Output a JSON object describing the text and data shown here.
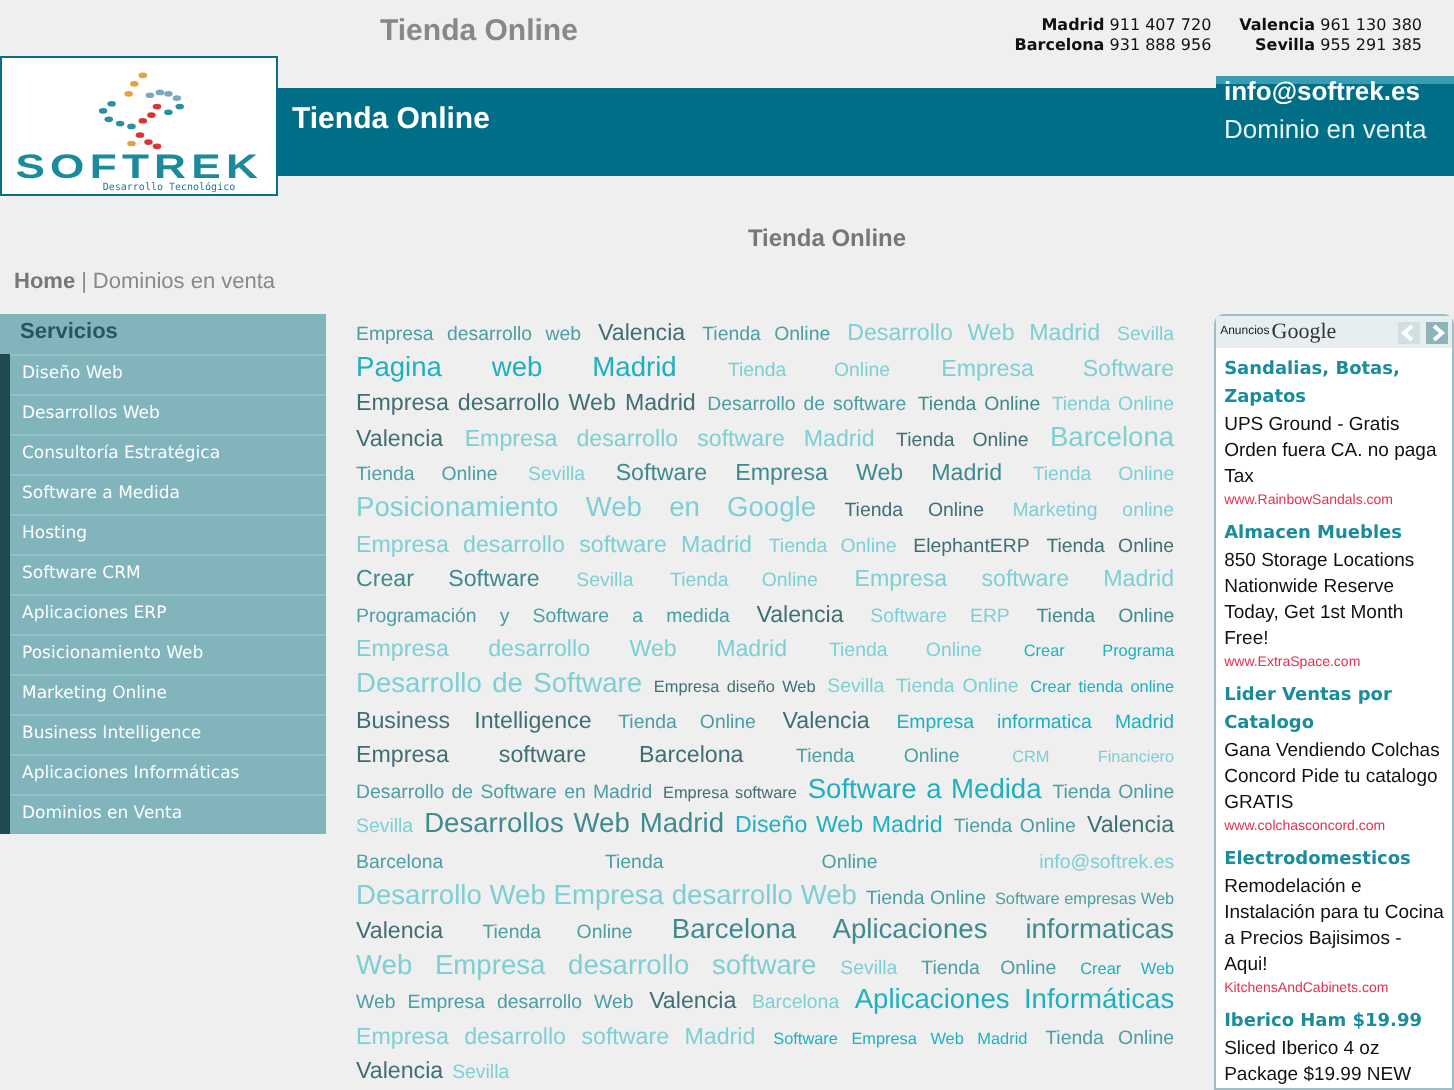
{
  "header": {
    "title": "Tienda Online",
    "phones": [
      {
        "city": "Madrid",
        "number": "911 407 720"
      },
      {
        "city": "Valencia",
        "number": "961 130 380"
      },
      {
        "city": "Barcelona",
        "number": "931 888 956"
      },
      {
        "city": "Sevilla",
        "number": "955 291 385"
      }
    ]
  },
  "logo": {
    "name": "SOFTREK",
    "tagline": "Desarrollo Tecnológico"
  },
  "banner": {
    "title": "Tienda Online",
    "email": "info@softrek.es",
    "note": "Dominio en venta"
  },
  "page_title": "Tienda Online",
  "breadcrumb": {
    "home": "Home",
    "separator": "|",
    "current": "Dominios en venta"
  },
  "sidebar": {
    "title": "Servicios",
    "items": [
      "Diseño Web",
      "Desarrollos Web",
      "Consultoría Estratégica",
      "Software a Medida",
      "Hosting",
      "Software CRM",
      "Aplicaciones ERP",
      "Posicionamiento Web",
      "Marketing Online",
      "Business Intelligence",
      "Aplicaciones Informáticas",
      "Dominios en Venta"
    ]
  },
  "tags": [
    {
      "text": "Empresa desarrollo web",
      "kind": "normal",
      "color": "#4c9ea4"
    },
    {
      "text": "Valencia",
      "kind": "major",
      "color": "#3f6f74"
    },
    {
      "text": "Tienda Online",
      "kind": "normal",
      "color": "#4c9ea4"
    },
    {
      "text": "Desarrollo Web Madrid",
      "kind": "major",
      "color": "#7dcfd4"
    },
    {
      "text": "Sevilla",
      "kind": "normal",
      "color": "#7dcfd4"
    },
    {
      "text": "Pagina web Madrid",
      "kind": "top",
      "color": "#1fb0c0"
    },
    {
      "text": "Tienda Online",
      "kind": "normal",
      "color": "#7dcfd4"
    },
    {
      "text": "Empresa Software",
      "kind": "major",
      "color": "#7dcfd4"
    },
    {
      "text": "Empresa desarrollo Web Madrid",
      "kind": "major",
      "color": "#3f6f74"
    },
    {
      "text": "Desarrollo de software",
      "kind": "normal",
      "color": "#4c9ea4"
    },
    {
      "text": "Tienda Online",
      "kind": "normal",
      "color": "#3f8a8f"
    },
    {
      "text": "Tienda Online",
      "kind": "normal",
      "color": "#7dcfd4"
    },
    {
      "text": "Valencia",
      "kind": "major",
      "color": "#3f6f74"
    },
    {
      "text": "Empresa desarrollo software Madrid",
      "kind": "major",
      "color": "#7dcfd4"
    },
    {
      "text": "Tienda Online",
      "kind": "normal",
      "color": "#3f6f74"
    },
    {
      "text": "Barcelona",
      "kind": "top",
      "color": "#7dcfd4"
    },
    {
      "text": "Tienda Online",
      "kind": "normal",
      "color": "#4c9ea4"
    },
    {
      "text": "Sevilla",
      "kind": "normal",
      "color": "#7dcfd4"
    },
    {
      "text": "Software Empresa Web Madrid",
      "kind": "major",
      "color": "#3f8a8f"
    },
    {
      "text": "Tienda Online",
      "kind": "normal",
      "color": "#7dcfd4"
    },
    {
      "text": "Posicionamiento Web en Google",
      "kind": "top",
      "color": "#7dcfd4"
    },
    {
      "text": "Tienda Online",
      "kind": "normal",
      "color": "#3f6f74"
    },
    {
      "text": "Marketing online",
      "kind": "normal",
      "color": "#7dcfd4"
    },
    {
      "text": "Empresa desarrollo software Madrid",
      "kind": "major",
      "color": "#7dcfd4"
    },
    {
      "text": "Tienda Online",
      "kind": "normal",
      "color": "#7dcfd4"
    },
    {
      "text": "ElephantERP",
      "kind": "normal",
      "color": "#3f6f74"
    },
    {
      "text": "Tienda Online",
      "kind": "normal",
      "color": "#3f6f74"
    },
    {
      "text": "Crear Software",
      "kind": "major",
      "color": "#3f8a8f"
    },
    {
      "text": "Sevilla",
      "kind": "normal",
      "color": "#7dcfd4"
    },
    {
      "text": "Tienda Online",
      "kind": "normal",
      "color": "#7dcfd4"
    },
    {
      "text": "Empresa software Madrid",
      "kind": "major",
      "color": "#7dcfd4"
    },
    {
      "text": "Programación y Software a medida",
      "kind": "normal",
      "color": "#4c9ea4"
    },
    {
      "text": "Valencia",
      "kind": "major",
      "color": "#3f6f74"
    },
    {
      "text": "Software ERP",
      "kind": "normal",
      "color": "#7dcfd4"
    },
    {
      "text": "Tienda Online",
      "kind": "normal",
      "color": "#3f8a8f"
    },
    {
      "text": "Empresa desarrollo Web Madrid",
      "kind": "major",
      "color": "#7dcfd4"
    },
    {
      "text": "Tienda Online",
      "kind": "normal",
      "color": "#7dcfd4"
    },
    {
      "text": "Crear Programa",
      "kind": "minor",
      "color": "#1fb0c0"
    },
    {
      "text": "Desarrollo de Software",
      "kind": "top",
      "color": "#7dcfd4"
    },
    {
      "text": "Empresa diseño Web",
      "kind": "minor",
      "color": "#3f6f74"
    },
    {
      "text": "Sevilla",
      "kind": "normal",
      "color": "#7dcfd4"
    },
    {
      "text": "Tienda Online",
      "kind": "normal",
      "color": "#7dcfd4"
    },
    {
      "text": "Crear tienda online",
      "kind": "minor",
      "color": "#1fb0c0"
    },
    {
      "text": "Business Intelligence",
      "kind": "major",
      "color": "#3f6f74"
    },
    {
      "text": "Tienda Online",
      "kind": "normal",
      "color": "#4c9ea4"
    },
    {
      "text": "Valencia",
      "kind": "major",
      "color": "#3f6f74"
    },
    {
      "text": "Empresa informatica Madrid",
      "kind": "normal",
      "color": "#1fb0c0"
    },
    {
      "text": "Empresa software",
      "kind": "major",
      "color": "#3f6f74"
    },
    {
      "text": "Barcelona",
      "kind": "major",
      "color": "#3f6f74"
    },
    {
      "text": "Tienda Online",
      "kind": "normal",
      "color": "#4c9ea4"
    },
    {
      "text": "CRM Financiero",
      "kind": "minor",
      "color": "#7dcfd4"
    },
    {
      "text": "Desarrollo de Software en Madrid",
      "kind": "normal",
      "color": "#4c9ea4"
    },
    {
      "text": "Empresa software",
      "kind": "minor",
      "color": "#3f6f74"
    },
    {
      "text": "Software a Medida",
      "kind": "top",
      "color": "#1fb0c0"
    },
    {
      "text": "Tienda Online",
      "kind": "normal",
      "color": "#4c9ea4"
    },
    {
      "text": "Sevilla",
      "kind": "normal",
      "color": "#7dcfd4"
    },
    {
      "text": "Desarrollos Web Madrid",
      "kind": "top",
      "color": "#3f8a8f"
    },
    {
      "text": "Diseño Web Madrid",
      "kind": "major",
      "color": "#1fb0c0"
    },
    {
      "text": "Tienda Online",
      "kind": "normal",
      "color": "#4c9ea4"
    },
    {
      "text": "Valencia",
      "kind": "major",
      "color": "#3f6f74"
    },
    {
      "text": "Barcelona",
      "kind": "normal",
      "color": "#4c9ea4"
    },
    {
      "text": "Tienda Online",
      "kind": "normal",
      "color": "#4c9ea4"
    },
    {
      "text": "info@softrek.es",
      "kind": "normal",
      "color": "#7dcfd4"
    },
    {
      "text": "Desarrollo Web Empresa desarrollo Web",
      "kind": "top",
      "color": "#7dcfd4"
    },
    {
      "text": "Tienda Online",
      "kind": "normal",
      "color": "#4c9ea4"
    },
    {
      "text": "Software empresas Web",
      "kind": "minor",
      "color": "#4c9ea4"
    },
    {
      "text": "Valencia",
      "kind": "major",
      "color": "#3f6f74"
    },
    {
      "text": "Tienda Online",
      "kind": "normal",
      "color": "#4c9ea4"
    },
    {
      "text": "Barcelona Aplicaciones informaticas",
      "kind": "top",
      "color": "#3f8a8f"
    },
    {
      "text": "Web Empresa desarrollo software",
      "kind": "top",
      "color": "#7dcfd4"
    },
    {
      "text": "Sevilla",
      "kind": "normal",
      "color": "#7dcfd4"
    },
    {
      "text": "Tienda Online",
      "kind": "normal",
      "color": "#4c9ea4"
    },
    {
      "text": "Crear Web",
      "kind": "minor",
      "color": "#1fb0c0"
    },
    {
      "text": "Web Empresa desarrollo Web",
      "kind": "normal",
      "color": "#4c9ea4"
    },
    {
      "text": "Valencia",
      "kind": "major",
      "color": "#3f6f74"
    },
    {
      "text": "Barcelona",
      "kind": "normal",
      "color": "#7dcfd4"
    },
    {
      "text": "Aplicaciones Informáticas",
      "kind": "top",
      "color": "#1fb0c0"
    },
    {
      "text": "Empresa desarrollo software Madrid",
      "kind": "major",
      "color": "#7dcfd4"
    },
    {
      "text": "Software Empresa Web Madrid",
      "kind": "minor",
      "color": "#1fb0c0"
    },
    {
      "text": "Tienda Online",
      "kind": "normal",
      "color": "#4c9ea4"
    },
    {
      "text": "Valencia",
      "kind": "major",
      "color": "#3f6f74"
    },
    {
      "text": "Sevilla",
      "kind": "normal",
      "color": "#7dcfd4"
    }
  ],
  "ads": {
    "label": "Anuncios",
    "brand": "Google",
    "items": [
      {
        "title": "Sandalias, Botas, Zapatos",
        "body": "UPS Ground - Gratis Orden fuera CA. no paga Tax",
        "url": "www.RainbowSandals.com"
      },
      {
        "title": "Almacen Muebles",
        "body": "850 Storage Locations Nationwide Reserve Today, Get 1st Month Free!",
        "url": "www.ExtraSpace.com"
      },
      {
        "title": "Lider Ventas por Catalogo",
        "body": "Gana Vendiendo Colchas Concord Pide tu catalogo GRATIS",
        "url": "www.colchasconcord.com"
      },
      {
        "title": "Electrodomesticos",
        "body": "Remodelación e Instalación para tu Cocina a Precios Bajisimos - Aqui!",
        "url": "KitchensAndCabinets.com"
      },
      {
        "title": "Iberico Ham $19.99",
        "body": "Sliced Iberico 4 oz Package $19.99 NEW"
      }
    ]
  }
}
